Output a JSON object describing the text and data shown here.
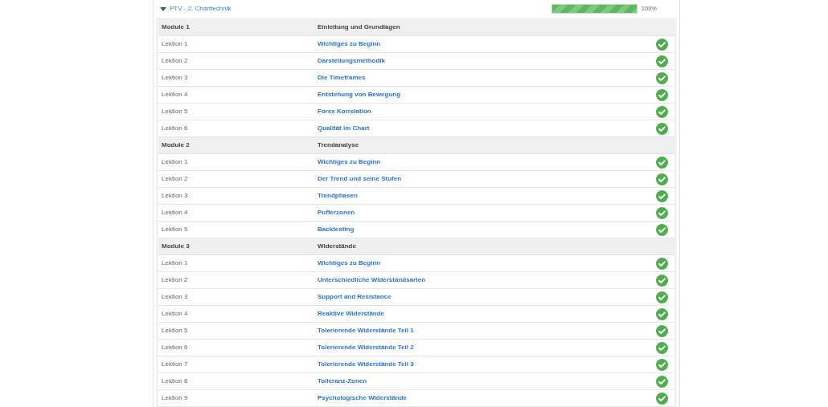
{
  "course": {
    "title": "PTV - 2. Charttechnik",
    "expanded": true,
    "progress": {
      "level": 1,
      "reading": "100%"
    }
  },
  "modules": [
    {
      "label": "Module 1",
      "title": "Einleitung und Grundlagen",
      "lessons": [
        {
          "label": "Lektion 1",
          "title": "Wichtiges zu Beginn",
          "completed": true
        },
        {
          "label": "Lektion 2",
          "title": "Darstellungsmethodik",
          "completed": true
        },
        {
          "label": "Lektion 3",
          "title": "Die Timeframes",
          "completed": true
        },
        {
          "label": "Lektion 4",
          "title": "Entstehung von Bewegung",
          "completed": true
        },
        {
          "label": "Lektion 5",
          "title": "Forex Korrelation",
          "completed": true
        },
        {
          "label": "Lektion 6",
          "title": "Qualität im Chart",
          "completed": true
        }
      ]
    },
    {
      "label": "Module 2",
      "title": "Trendanalyse",
      "lessons": [
        {
          "label": "Lektion 1",
          "title": "Wichtiges zu Beginn",
          "completed": true
        },
        {
          "label": "Lektion 2",
          "title": "Der Trend und seine Stufen",
          "completed": true
        },
        {
          "label": "Lektion 3",
          "title": "Trendphasen",
          "completed": true
        },
        {
          "label": "Lektion 4",
          "title": "Pufferzonen",
          "completed": true
        },
        {
          "label": "Lektion 5",
          "title": "Backtesting",
          "completed": true
        }
      ]
    },
    {
      "label": "Module 3",
      "title": "Widerstände",
      "lessons": [
        {
          "label": "Lektion 1",
          "title": "Wichtiges zu Beginn",
          "completed": true
        },
        {
          "label": "Lektion 2",
          "title": "Unterschiedliche Widerstandsarten",
          "completed": true
        },
        {
          "label": "Lektion 3",
          "title": "Support and Resistance",
          "completed": true
        },
        {
          "label": "Lektion 4",
          "title": "Reaktive Widerstände",
          "completed": true
        },
        {
          "label": "Lektion 5",
          "title": "Tolerierende Widerstände Teil 1",
          "completed": true
        },
        {
          "label": "Lektion 6",
          "title": "Tolerierende Widerstände Teil 2",
          "completed": true
        },
        {
          "label": "Lektion 7",
          "title": "Tolerierende Widerstände Teil 3",
          "completed": true
        },
        {
          "label": "Lektion 8",
          "title": "Tolleranz-Zonen",
          "completed": true
        },
        {
          "label": "Lektion 9",
          "title": "Psychologische Widerstände",
          "completed": true
        }
      ]
    }
  ]
}
